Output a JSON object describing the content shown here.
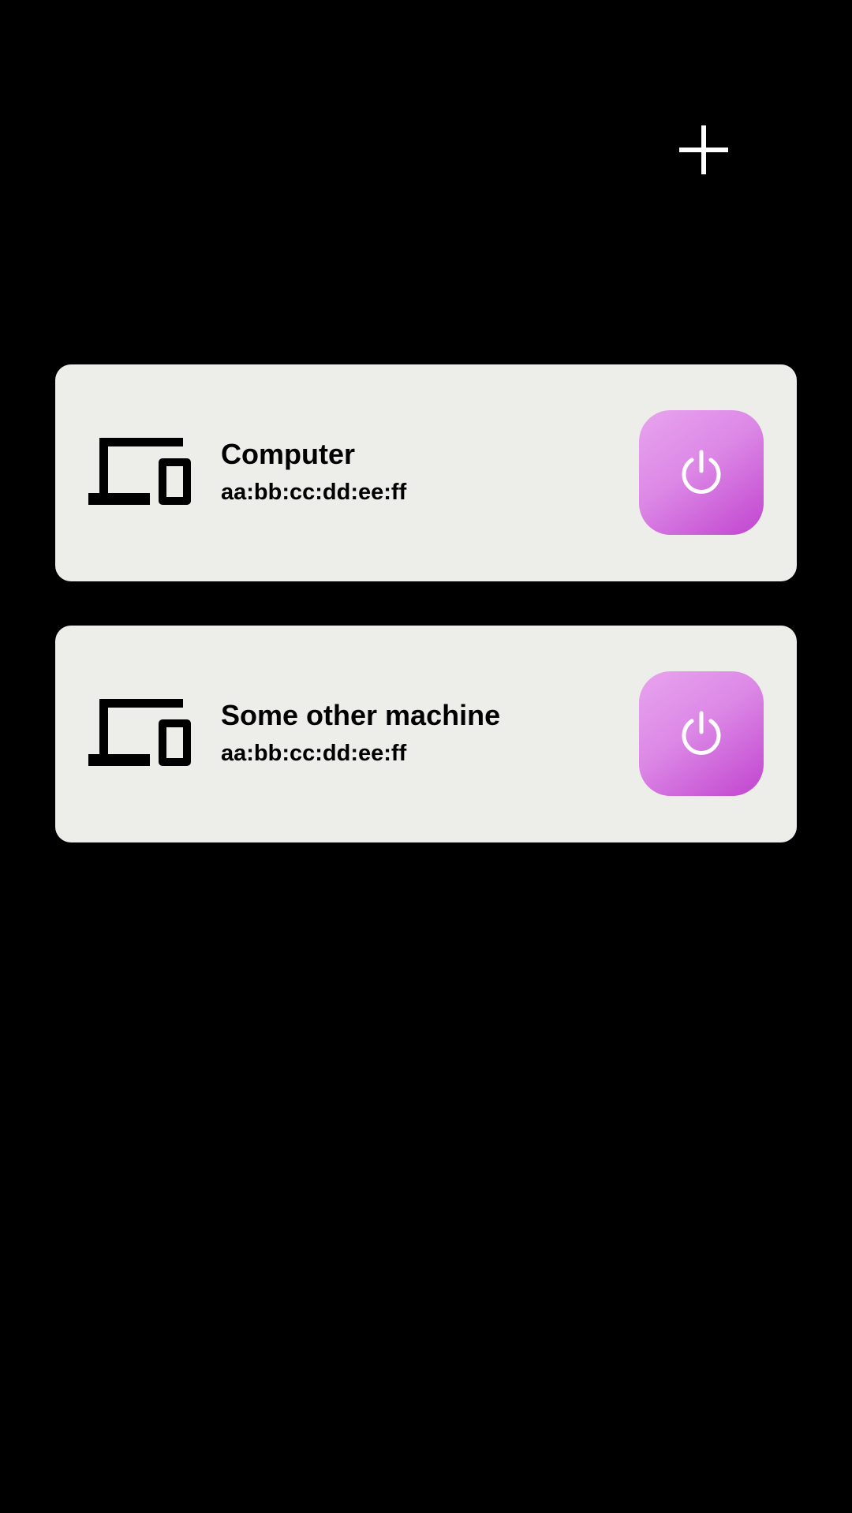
{
  "header": {
    "add_icon": "plus-icon"
  },
  "devices": [
    {
      "name": "Computer",
      "mac": "aa:bb:cc:dd:ee:ff",
      "icon": "devices-icon",
      "action_icon": "power-icon"
    },
    {
      "name": "Some other machine",
      "mac": "aa:bb:cc:dd:ee:ff",
      "icon": "devices-icon",
      "action_icon": "power-icon"
    }
  ],
  "colors": {
    "background": "#000000",
    "card": "#ededea",
    "accent_light": "#e8a4ee",
    "accent_dark": "#c144cf",
    "icon_on_accent": "#ffffff"
  }
}
